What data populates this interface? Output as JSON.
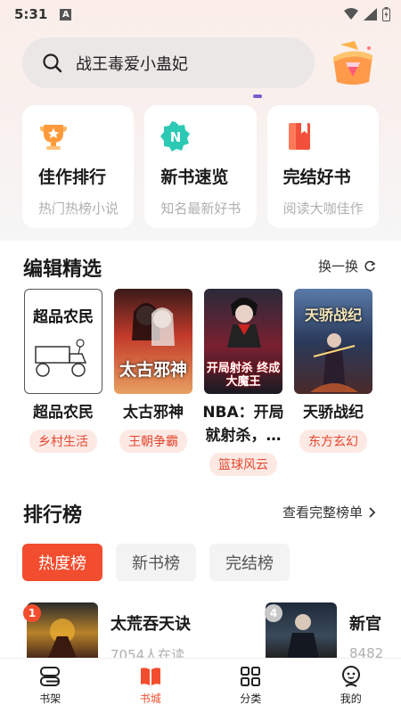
{
  "status": {
    "time": "5:31",
    "indicator": "A"
  },
  "search": {
    "text": "战王毒爱小蛊妃"
  },
  "feature_cards": [
    {
      "title": "佳作排行",
      "subtitle": "热门热榜小说",
      "icon": "trophy-icon"
    },
    {
      "title": "新书速览",
      "subtitle": "知名最新好书",
      "icon": "new-badge-icon"
    },
    {
      "title": "完结好书",
      "subtitle": "阅读大咖佳作",
      "icon": "book-icon"
    }
  ],
  "editor_picks": {
    "title": "编辑精选",
    "swap_label": "换一换",
    "books": [
      {
        "title": "超品农民",
        "tag": "乡村生活",
        "cover_text": "超品农民"
      },
      {
        "title": "太古邪神",
        "tag": "王朝争霸",
        "cover_text": "太古邪神"
      },
      {
        "title": "NBA：开局就射杀，…",
        "tag": "篮球风云",
        "cover_text": "开局射杀 终成大魔王"
      },
      {
        "title": "天骄战纪",
        "tag": "东方玄幻",
        "cover_text": "天骄战纪"
      }
    ]
  },
  "ranking": {
    "title": "排行榜",
    "more_label": "查看完整榜单",
    "tabs": [
      {
        "label": "热度榜",
        "active": true
      },
      {
        "label": "新书榜",
        "active": false
      },
      {
        "label": "完结榜",
        "active": false
      }
    ],
    "items": [
      {
        "rank": "1",
        "name": "太荒吞天诀",
        "readers": "7054人在读"
      },
      {
        "rank": "4",
        "name": "新官",
        "readers": "8482"
      }
    ]
  },
  "bottom_nav": [
    {
      "label": "书架",
      "icon": "bookshelf-icon",
      "active": false
    },
    {
      "label": "书城",
      "icon": "bookstore-icon",
      "active": true
    },
    {
      "label": "分类",
      "icon": "category-grid-icon",
      "active": false
    },
    {
      "label": "我的",
      "icon": "profile-icon",
      "active": false
    }
  ],
  "colors": {
    "accent": "#f24d2e",
    "tag_bg": "#fde9e4",
    "tag_text": "#e4472f"
  }
}
